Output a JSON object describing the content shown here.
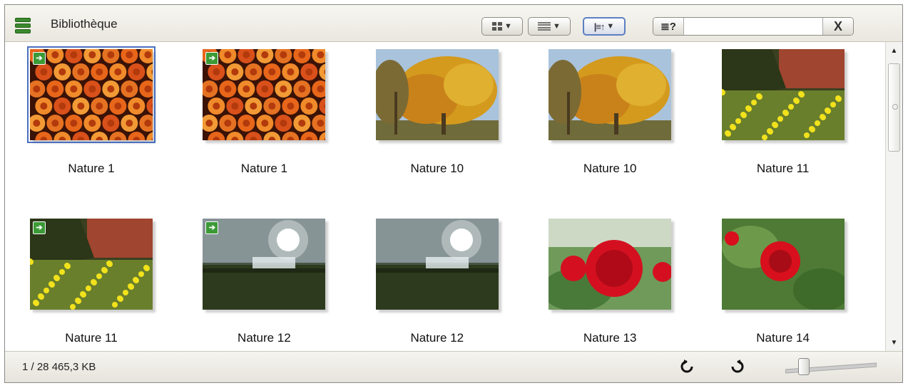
{
  "toolbar": {
    "title": "Bibliothèque",
    "library_icon": "library-stack-icon",
    "view_grid_button": "grid-view-icon",
    "view_list_button": "list-view-icon",
    "sort_button": "sort-icon",
    "search_help_icon": "≣?",
    "search_value": "",
    "clear_label": "X"
  },
  "items": [
    {
      "label": "Nature 1",
      "image": "roses-orange",
      "selected": true,
      "badge": true
    },
    {
      "label": "Nature 1",
      "image": "roses-orange",
      "selected": false,
      "badge": true
    },
    {
      "label": "Nature 10",
      "image": "autumn-tree",
      "selected": false,
      "badge": false
    },
    {
      "label": "Nature 10",
      "image": "autumn-tree",
      "selected": false,
      "badge": false
    },
    {
      "label": "Nature 11",
      "image": "daffodils",
      "selected": false,
      "badge": false
    },
    {
      "label": "Nature 11",
      "image": "daffodils",
      "selected": false,
      "badge": true
    },
    {
      "label": "Nature 12",
      "image": "fountain-sunlight",
      "selected": false,
      "badge": true
    },
    {
      "label": "Nature 12",
      "image": "fountain-sunlight",
      "selected": false,
      "badge": false
    },
    {
      "label": "Nature 13",
      "image": "red-rose-large",
      "selected": false,
      "badge": false
    },
    {
      "label": "Nature 14",
      "image": "red-rose-garden",
      "selected": false,
      "badge": false
    }
  ],
  "status": {
    "text": "1 / 28  465,3 KB",
    "rotate_left_icon": "rotate-left-icon",
    "rotate_right_icon": "rotate-right-icon",
    "zoom_level": 0.2
  },
  "colors": {
    "accent": "#4a6fbf",
    "badge": "#3c9a36"
  }
}
